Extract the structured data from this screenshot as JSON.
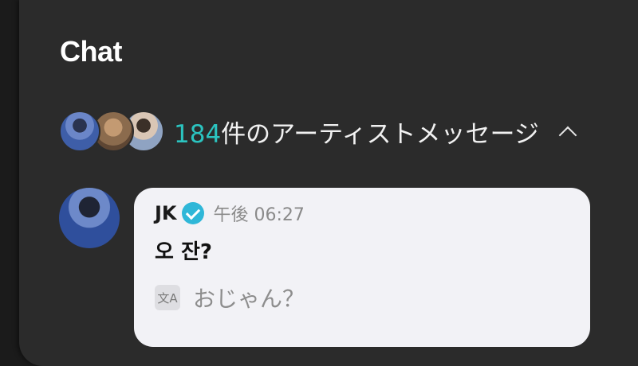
{
  "header": {
    "title": "Chat"
  },
  "artist_summary": {
    "count": "184",
    "label": "件のアーティストメッセージ",
    "toggle_icon": "chevron-up-icon"
  },
  "message": {
    "sender": "JK",
    "verified_icon": "verified-badge-icon",
    "time": "午後 06:27",
    "text": "오 잔?",
    "translate_icon": "translate-icon",
    "translate_glyph": "文A",
    "translation": "おじゃん？"
  },
  "colors": {
    "accent": "#2bc4c0",
    "panel": "#2b2b2b",
    "bubble": "#f2f2f6"
  }
}
